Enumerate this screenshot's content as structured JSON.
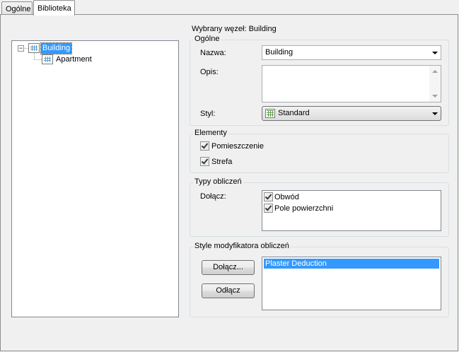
{
  "tabs": [
    {
      "label": "Ogólne"
    },
    {
      "label": "Biblioteka"
    }
  ],
  "tree": {
    "root": {
      "label": "Building"
    },
    "child": {
      "label": "Apartment"
    }
  },
  "selected_node": {
    "prefix": "Wybrany węzeł: ",
    "value": "Building"
  },
  "general": {
    "legend": "Ogólne",
    "name_label": "Nazwa:",
    "name_value": "Building",
    "description_label": "Opis:",
    "description_value": "",
    "style_label": "Styl:",
    "style_value": "Standard"
  },
  "elements": {
    "legend": "Elementy",
    "items": [
      {
        "label": "Pomieszczenie",
        "checked": true
      },
      {
        "label": "Strefa",
        "checked": true
      }
    ]
  },
  "calc_types": {
    "legend": "Typy obliczeń",
    "attach_label": "Dołącz:",
    "items": [
      {
        "label": "Obwód",
        "checked": true
      },
      {
        "label": "Pole powierzchni",
        "checked": true
      }
    ]
  },
  "modifiers": {
    "legend": "Style modyfikatora obliczeń",
    "attach_button": "Dołącz...",
    "detach_button": "Odłącz",
    "items": [
      {
        "label": "Plaster Deduction",
        "selected": true
      }
    ]
  },
  "colors": {
    "selection": "#3399ff",
    "panel": "#f0f0f0"
  }
}
